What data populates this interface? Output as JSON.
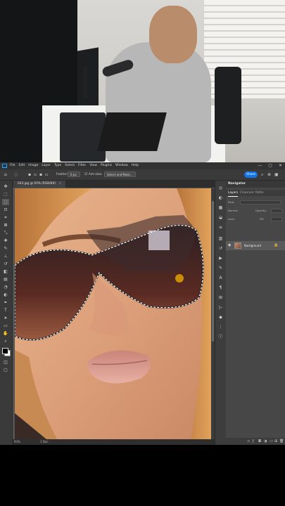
{
  "app": {
    "logo": "Ps"
  },
  "menu": [
    "File",
    "Edit",
    "Image",
    "Layer",
    "Type",
    "Select",
    "Filter",
    "View",
    "Plugins",
    "Window",
    "Help"
  ],
  "window_controls": [
    "—",
    "▢",
    "✕"
  ],
  "options": {
    "feather_label": "Feather:",
    "feather_value": "0 px",
    "antialias_label": "Anti-alias",
    "select_mask_label": "Select and Mask...",
    "share_label": "Share"
  },
  "document": {
    "tab_title": "043.jpg @ 93% (RGB/8#)",
    "close": "×",
    "zoom": "93%",
    "status_info": "1 Doc"
  },
  "panels": {
    "navigator_title": "Navigator",
    "tabs": [
      "Layers",
      "Channels",
      "Paths"
    ],
    "search_placeholder": "Kind",
    "blend_mode": "Normal",
    "opacity_label": "Opacity:",
    "lock_label": "Lock:",
    "fill_label": "Fill:"
  },
  "layer": {
    "name": "Background",
    "visible_icon": "eye-icon",
    "lock_icon": "lock-icon"
  },
  "bottom_icons": [
    "link-icon",
    "fx-icon",
    "mask-icon",
    "adjustment-icon",
    "folder-icon",
    "new-layer-icon",
    "trash-icon"
  ],
  "colors": {
    "menubar": "#323232",
    "panel_bg": "#474747",
    "accent": "#1473e6",
    "selection": "#ffffff"
  }
}
